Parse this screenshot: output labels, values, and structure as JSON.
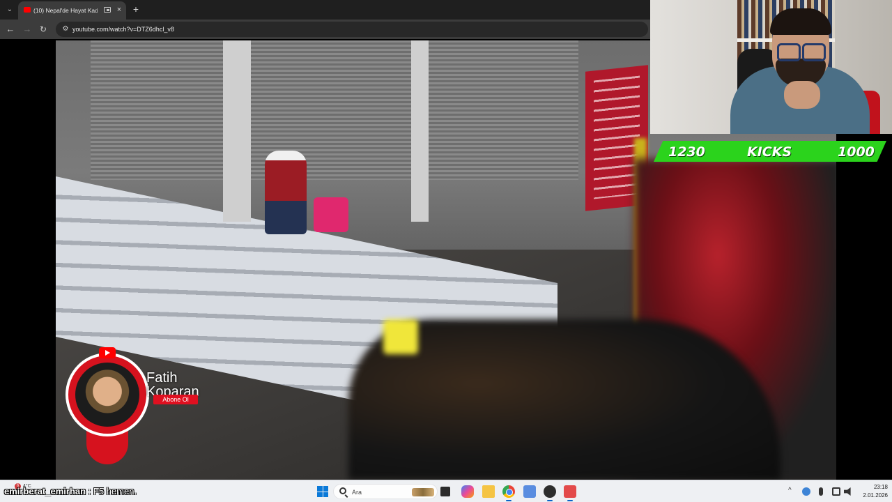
{
  "browser": {
    "tab": {
      "title": "(10) Nepal'de Hayat Kadınl",
      "favicon": "youtube-icon"
    },
    "new_tab": "+",
    "url": "youtube.com/watch?v=DTZ6dhcl_v8"
  },
  "video": {
    "channel_name": "Fatih Koparan",
    "subscribe_label": "Abone Ol"
  },
  "stream_goal": {
    "current": "1230",
    "label": "KICKS",
    "target": "1000",
    "accent": "#2bd31c"
  },
  "chat": {
    "username": "emirberat_emirhan",
    "separator": ":",
    "message": "F5 hemen."
  },
  "taskbar": {
    "badge": "6",
    "widget_temp": "4°C",
    "search_placeholder": "Ara",
    "apps": [
      "task-view-icon",
      "copilot-icon",
      "file-explorer-icon",
      "chrome-icon",
      "snipping-tool-icon",
      "obs-icon",
      "streaming-app-icon"
    ],
    "time": "23:18",
    "date": "2.01.2026"
  }
}
